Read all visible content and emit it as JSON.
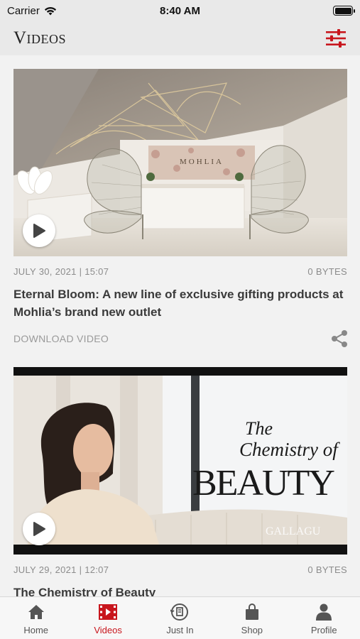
{
  "status_bar": {
    "carrier": "Carrier",
    "time": "8:40 AM"
  },
  "header": {
    "title": "Videos"
  },
  "videos": [
    {
      "date": "JULY 30, 2021 | 15:07",
      "size": "0 BYTES",
      "title": "Eternal Bloom: A new line of exclusive gifting products at Mohlia’s brand new outlet",
      "download_label": "DOWNLOAD VIDEO",
      "thumb_text": "MOHLIA"
    },
    {
      "date": "JULY 29, 2021 | 12:07",
      "size": "0 BYTES",
      "title": "The Chemistry of Beauty",
      "thumb_text_1": "The",
      "thumb_text_2": "Chemistry of",
      "thumb_text_3": "BEAUTY",
      "thumb_text_4": "GALLAGU"
    }
  ],
  "tabs": [
    {
      "label": "Home",
      "icon": "home-icon"
    },
    {
      "label": "Videos",
      "icon": "video-icon",
      "active": true
    },
    {
      "label": "Just In",
      "icon": "just-in-icon"
    },
    {
      "label": "Shop",
      "icon": "shopping-bag-icon"
    },
    {
      "label": "Profile",
      "icon": "profile-icon"
    }
  ],
  "colors": {
    "accent": "#c8161d",
    "background": "#f2f2f2",
    "header": "#e9e9e9"
  }
}
